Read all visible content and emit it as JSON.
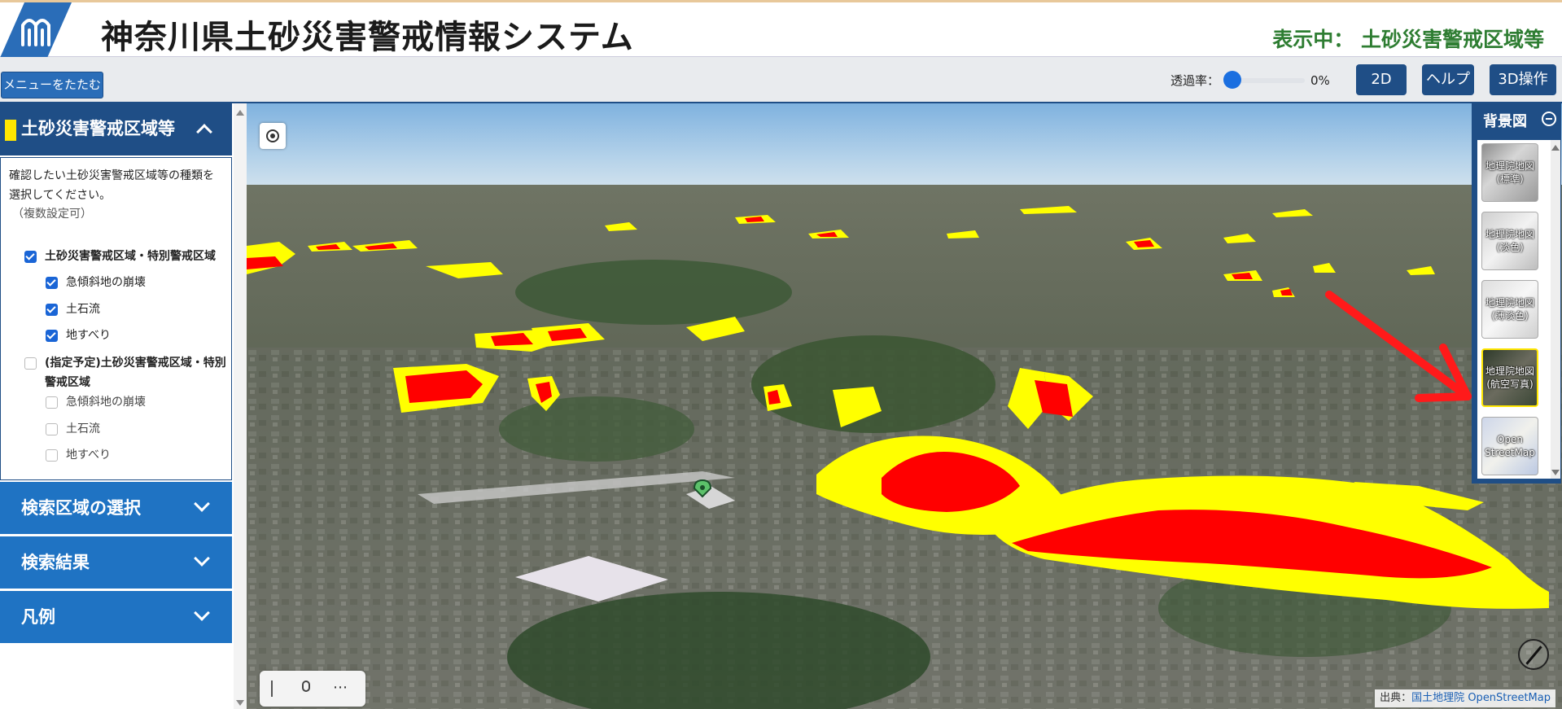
{
  "header": {
    "title": "神奈川県土砂災害警戒情報システム",
    "showing_label": "表示中： 土砂災害警戒区域等"
  },
  "toolbar": {
    "menu_toggle": "メニューをたたむ",
    "opacity_label": "透過率：",
    "opacity_value": "0%",
    "opacity_fraction": 0,
    "btn_2d": "2D",
    "btn_help": "ヘルプ",
    "btn_3d": "3D操作"
  },
  "sidebar": {
    "panel_title": "土砂災害警戒区域等",
    "swatch_color": "#ffe600",
    "description": "確認したい土砂災害警戒区域等の種類を選択してください。",
    "note": "（複数設定可）",
    "groups": [
      {
        "label": "土砂災害警戒区域・特別警戒区域",
        "checked": true,
        "children": [
          {
            "label": "急傾斜地の崩壊",
            "checked": true
          },
          {
            "label": "土石流",
            "checked": true
          },
          {
            "label": "地すべり",
            "checked": true
          }
        ]
      },
      {
        "label": "(指定予定)土砂災害警戒区域・特別警戒区域",
        "checked": false,
        "children": [
          {
            "label": "急傾斜地の崩壊",
            "checked": false
          },
          {
            "label": "土石流",
            "checked": false
          },
          {
            "label": "地すべり",
            "checked": false
          }
        ]
      }
    ],
    "accordions": {
      "search_area": "検索区域の選択",
      "results": "検索結果",
      "legend": "凡例"
    }
  },
  "basemap": {
    "title": "背景図",
    "options": [
      {
        "label": "地理院地図(標準)",
        "selected": false
      },
      {
        "label": "地理院地図(淡色)",
        "selected": false
      },
      {
        "label": "地理院地図(薄淡色)",
        "selected": false
      },
      {
        "label": "地理院地図(航空写真)",
        "selected": true
      },
      {
        "label": "Open StreetMap",
        "selected": false
      }
    ]
  },
  "attribution": {
    "prefix": "出典：",
    "gsi": "国土地理院",
    "osm": "OpenStreetMap"
  },
  "colors": {
    "header_blue": "#1f4e86",
    "accordion_blue": "#1f73c3",
    "showing_green": "#2e7d32",
    "special_zone": "#ff0000",
    "warning_zone": "#ffff00",
    "annotation_arrow": "#ff1a1a"
  },
  "icons": {
    "logo": "kanagawa-logo-icon",
    "locate": "locate-icon",
    "mic": "microphone-icon",
    "more": "more-icon",
    "compass": "compass-icon",
    "collapse": "minus-circle-icon",
    "accordion": "chevron-icon"
  }
}
